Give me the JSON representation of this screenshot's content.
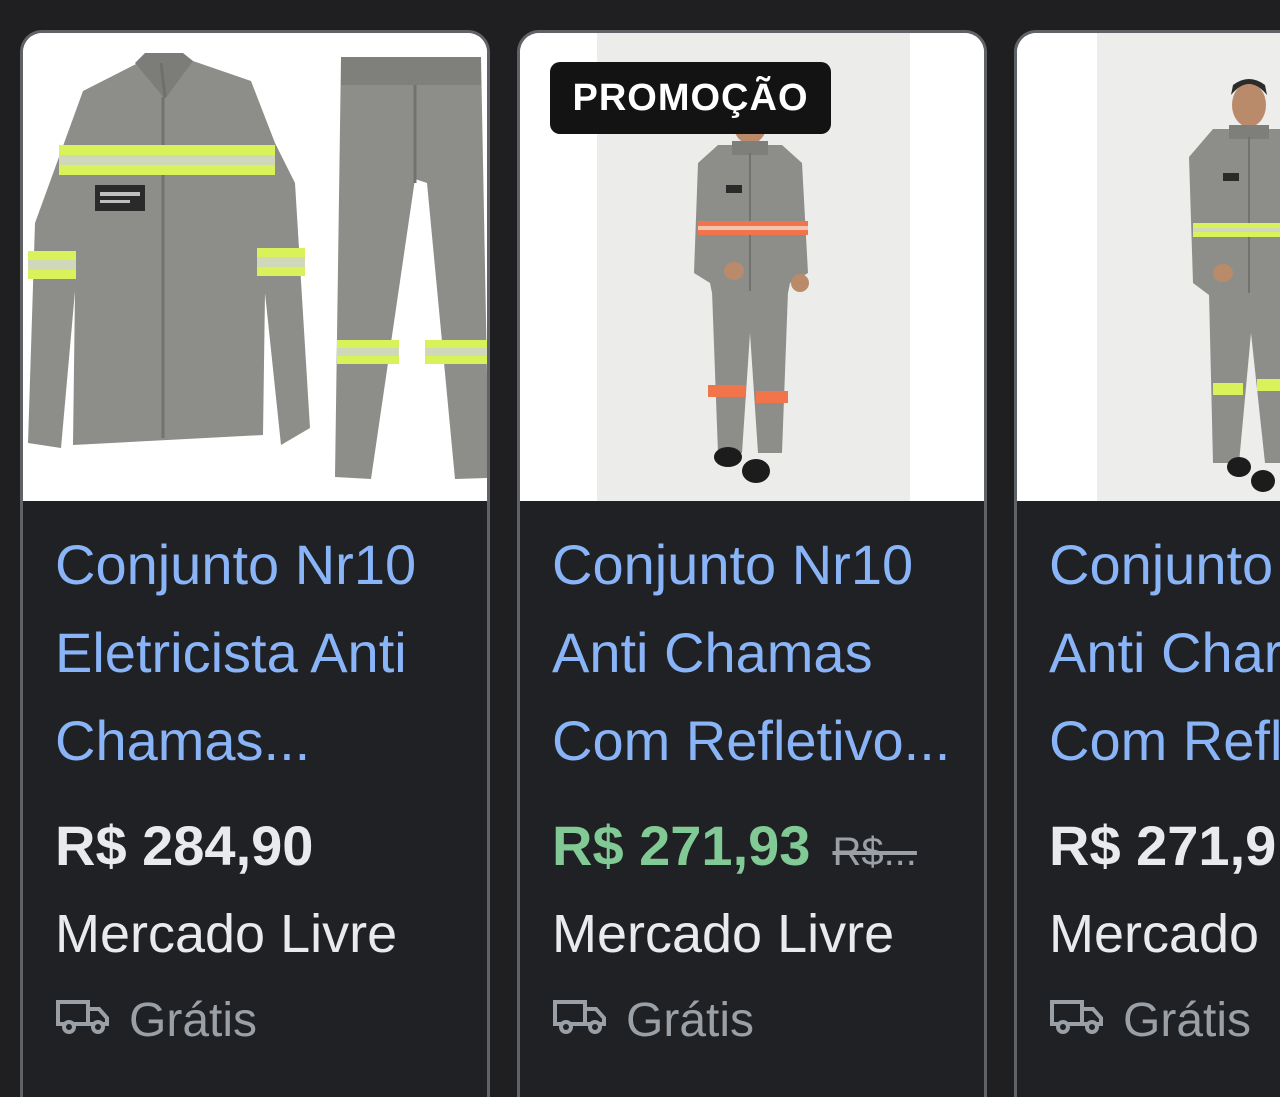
{
  "products": [
    {
      "title": "Conjunto Nr10\nEletricista Anti\nChamas...",
      "price": "R$ 284,90",
      "old_price": "",
      "seller": "Mercado Livre",
      "shipping": "Grátis",
      "badge": "",
      "image_icon": "clothing-set-image"
    },
    {
      "title": "Conjunto Nr10\nAnti Chamas\nCom Refletivo...",
      "price": "R$ 271,93",
      "old_price": "R$...",
      "seller": "Mercado Livre",
      "shipping": "Grátis",
      "badge": "PROMOÇÃO",
      "image_icon": "model-wearing-uniform-image"
    },
    {
      "title": "Conjunto\nAnti Char\nCom Refl",
      "price": "R$ 271,9",
      "old_price": "",
      "seller": "Mercado",
      "shipping": "Grátis",
      "badge": "",
      "image_icon": "model-wearing-uniform-image"
    }
  ],
  "colors": {
    "background": "#1f1f21",
    "title_link": "#8ab4f8",
    "sale_price": "#81c995",
    "price": "#e8eaed",
    "muted": "#9aa0a6",
    "reflective_yellow": "#d9f25a",
    "reflective_orange": "#f2744a",
    "uniform_gray": "#8d8e89"
  }
}
